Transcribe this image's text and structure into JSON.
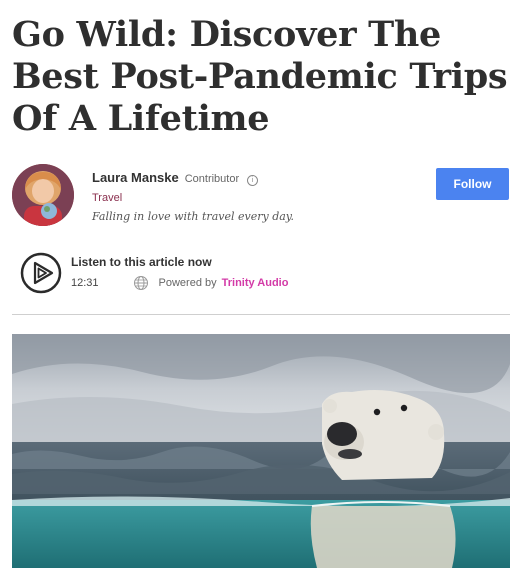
{
  "article": {
    "headline": "Go Wild: Discover The Best Post-Pandemic Trips Of A Lifetime"
  },
  "author": {
    "name": "Laura Manske",
    "role": "Contributor",
    "section": "Travel",
    "bio": "Falling in love with travel every day.",
    "follow_label": "Follow"
  },
  "audio": {
    "title": "Listen to this article now",
    "duration": "12:31",
    "powered_by": "Powered by",
    "brand": "Trinity Audio"
  },
  "colors": {
    "follow_button": "#4b83f0",
    "section_link": "#8a2f4e",
    "brand_accent": "#d33aa7"
  },
  "icons": {
    "info": "info-icon",
    "play": "play-icon",
    "globe": "globe-icon"
  }
}
